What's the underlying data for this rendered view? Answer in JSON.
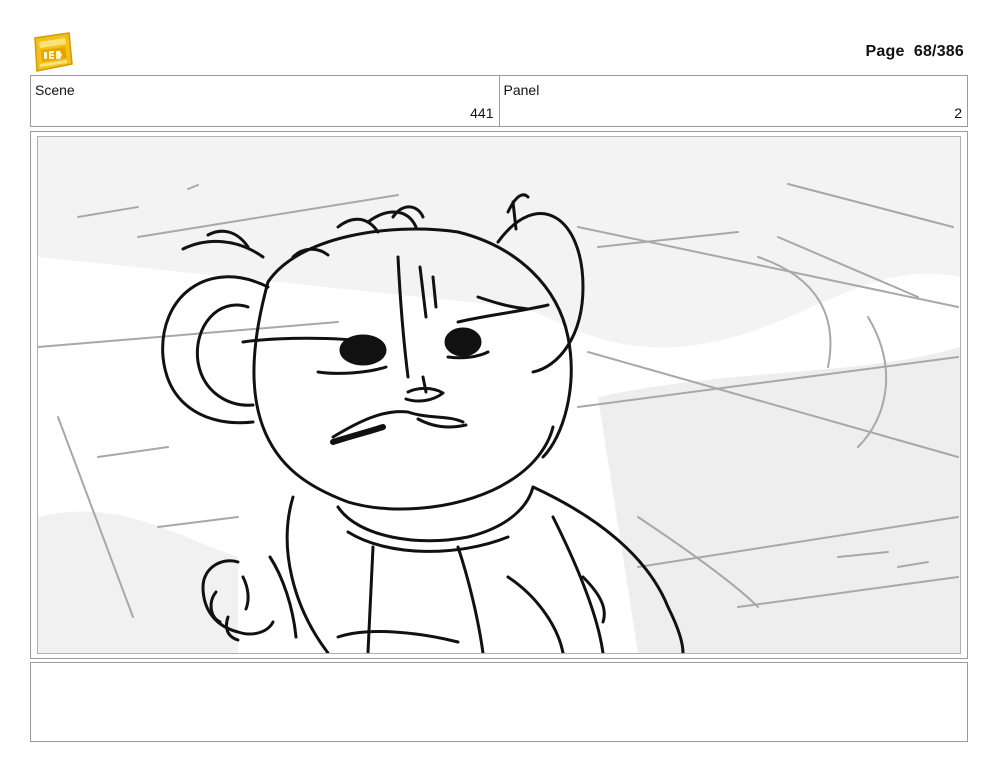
{
  "header": {
    "logo_icon": "young-jedi-adventures-logo",
    "page_label": "Page",
    "page_number": "68/386",
    "brand_color": "#f2c21b"
  },
  "info": {
    "scene_label": "Scene",
    "scene_value": "441",
    "panel_label": "Panel",
    "panel_value": "2"
  },
  "panel": {
    "art_icon": "storyboard-sketch-mouse-character"
  },
  "notes": {
    "text": ""
  }
}
